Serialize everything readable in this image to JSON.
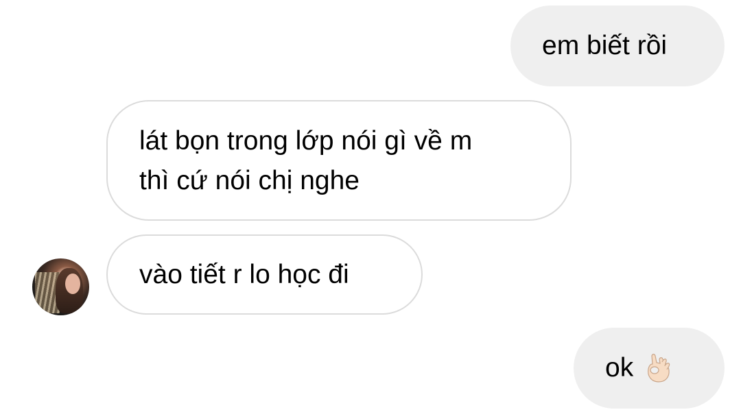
{
  "conversation": {
    "messages": [
      {
        "direction": "outgoing",
        "lines": [
          "em biết rồi"
        ]
      },
      {
        "direction": "incoming",
        "lines": [
          "lát bọn trong lớp nói gì về m",
          "thì cứ nói chị nghe"
        ]
      },
      {
        "direction": "incoming",
        "lines": [
          "vào tiết r lo học đi"
        ]
      },
      {
        "direction": "outgoing",
        "lines": [
          "ok"
        ],
        "emoji": "ok-hand-emoji"
      }
    ],
    "avatar": "contact-avatar"
  },
  "colors": {
    "outgoing_bubble": "#efefef",
    "incoming_border": "#dbdbdb",
    "text": "#000000",
    "background": "#ffffff"
  }
}
